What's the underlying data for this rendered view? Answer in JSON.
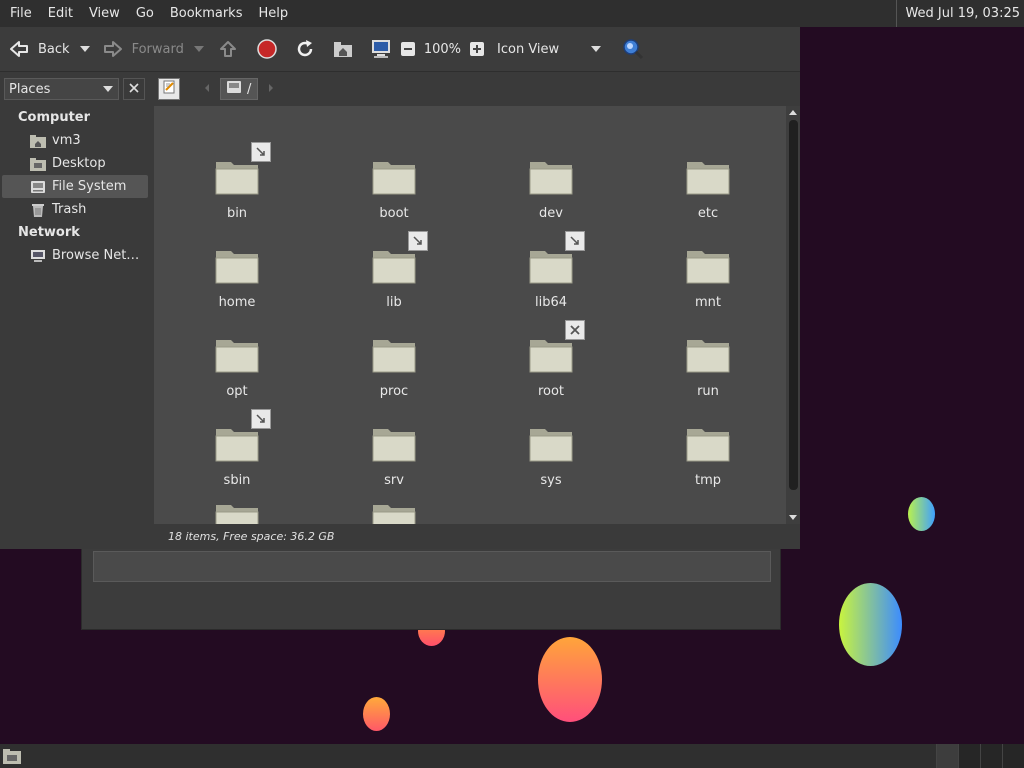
{
  "menubar": {
    "items": [
      "File",
      "Edit",
      "View",
      "Go",
      "Bookmarks",
      "Help"
    ],
    "clock": "Wed Jul 19, 03:25"
  },
  "toolbar": {
    "back_label": "Back",
    "forward_label": "Forward",
    "zoom_level": "100%",
    "view_mode": "Icon View"
  },
  "sidebar": {
    "selector_value": "Places",
    "sections": [
      {
        "title": "Computer",
        "items": [
          {
            "label": "vm3",
            "icon": "home-folder-icon"
          },
          {
            "label": "Desktop",
            "icon": "desktop-folder-icon"
          },
          {
            "label": "File System",
            "icon": "drive-icon",
            "selected": true
          },
          {
            "label": "Trash",
            "icon": "trash-icon"
          }
        ]
      },
      {
        "title": "Network",
        "items": [
          {
            "label": "Browse Net…",
            "icon": "network-icon"
          }
        ]
      }
    ]
  },
  "pathbar": {
    "current": "/"
  },
  "files": [
    {
      "name": "bin",
      "emblem": "symlink"
    },
    {
      "name": "boot"
    },
    {
      "name": "dev"
    },
    {
      "name": "etc"
    },
    {
      "name": "home"
    },
    {
      "name": "lib",
      "emblem": "symlink"
    },
    {
      "name": "lib64",
      "emblem": "symlink"
    },
    {
      "name": "mnt"
    },
    {
      "name": "opt"
    },
    {
      "name": "proc"
    },
    {
      "name": "root",
      "emblem": "unreadable"
    },
    {
      "name": "run"
    },
    {
      "name": "sbin",
      "emblem": "symlink"
    },
    {
      "name": "srv"
    },
    {
      "name": "sys"
    },
    {
      "name": "tmp"
    },
    {
      "name": ""
    },
    {
      "name": ""
    }
  ],
  "status": "18 items, Free space: 36.2 GB",
  "colors": {
    "folder": "#d9d9c8",
    "stop": "#c62828",
    "search": "#3f7fd6"
  }
}
